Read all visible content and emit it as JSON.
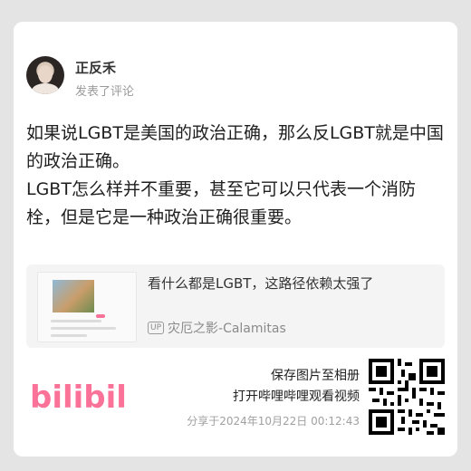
{
  "comment": {
    "username": "正反禾",
    "action": "发表了评论",
    "paragraphs": [
      "如果说LGBT是美国的政治正确，那么反LGBT就是中国的政治正确。",
      "LGBT怎么样并不重要，甚至它可以只代表一个消防栓，但是它是一种政治正确很重要。"
    ]
  },
  "embed": {
    "title": "看什么都是LGBT，这路径依赖太强了",
    "up_badge": "UP",
    "author": "灾厄之影-Calamitas"
  },
  "footer": {
    "logo_text": "bilibili",
    "save_line1": "保存图片至相册",
    "save_line2": "打开哔哩哔哩观看视频",
    "share_time": "分享于2024年10月22日 00:12:43"
  },
  "colors": {
    "brand_pink": "#fb7299",
    "background": "#e4e4e4"
  }
}
